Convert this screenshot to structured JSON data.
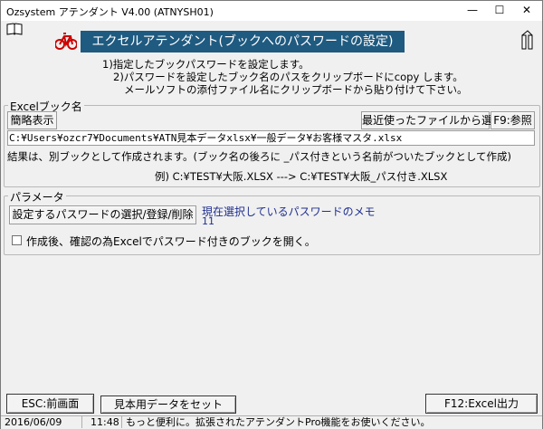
{
  "window": {
    "title": "Ozsystem アテンダント V4.00 (ATNYSH01)",
    "min_glyph": "—",
    "max_glyph": "☐",
    "close_glyph": "✕"
  },
  "header": {
    "banner": "エクセルアテンダント(ブックへのパスワードの設定)"
  },
  "instructions": {
    "line1": "1)指定したブックパスワードを設定します。",
    "line2": "2)パスワードを設定したブック名のパスをクリップボードにcopy します。",
    "line3": "メールソフトの添付ファイル名にクリップボードから貼り付けて下さい。"
  },
  "excel_group": {
    "title": "Excelブック名",
    "simple_view_button": "簡略表示",
    "recent_button": "最近使ったファイルから選択",
    "browse_button": "F9:参照",
    "path_value": "C:¥Users¥ozcr7¥Documents¥ATN見本データxlsx¥一般データ¥お客様マスタ.xlsx",
    "result_note": "結果は、別ブックとして作成されます。(ブック名の後ろに _パス付きという名前がついたブックとして作成)",
    "example": "例)  C:¥TEST¥大阪.XLSX  --->  C:¥TEST¥大阪_パス付き.XLSX"
  },
  "param_group": {
    "title": "パラメータ",
    "select_password_button": "設定するパスワードの選択/登録/削除",
    "memo_label": "現在選択しているパスワードのメモ",
    "memo_value": "11",
    "open_after_label": "作成後、確認の為Excelでパスワード付きのブックを開く。",
    "open_after_checked": false
  },
  "footer": {
    "esc_button": "ESC:前画面",
    "sample_button": "見本用データをセット",
    "excel_output_button": "F12:Excel出力"
  },
  "statusbar": {
    "date": "2016/06/09",
    "time": "11:48",
    "message": "もっと便利に。拡張されたアテンダントPro機能をお使いください。"
  },
  "colors": {
    "banner_bg": "#1f5a80",
    "memo_label": "#1f2f8f"
  },
  "icons": [
    "book-icon",
    "bicycle-icon",
    "tower-icon"
  ]
}
